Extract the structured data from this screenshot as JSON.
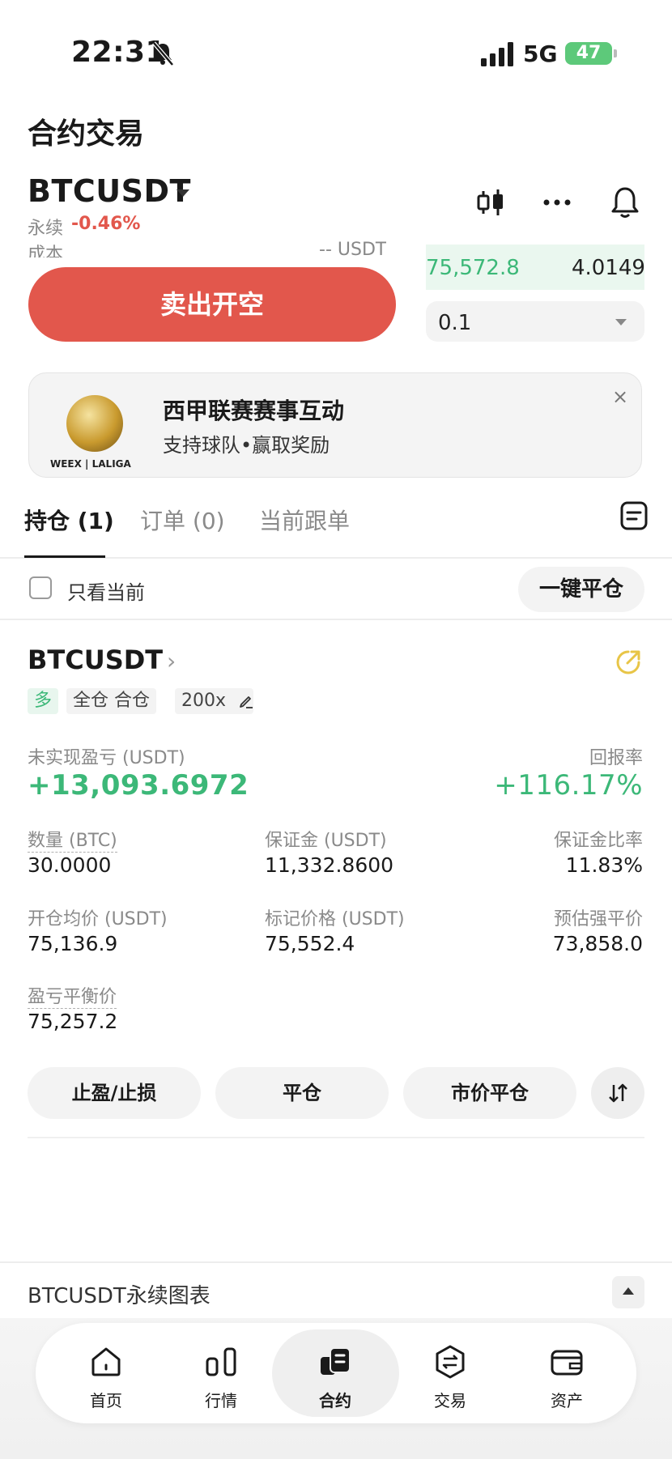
{
  "status_bar": {
    "time": "22:31",
    "network": "5G",
    "battery": "47"
  },
  "header": {
    "title": "合约交易"
  },
  "symbol": {
    "name": "BTCUSDT",
    "type": "永续",
    "change": "-0.46%"
  },
  "order_form": {
    "cost_label": "成本",
    "cost_value": "-- USDT",
    "sell_button": "卖出开空",
    "amount": "0.1"
  },
  "orderbook_row": {
    "price": "75,572.8",
    "qty": "4.0149"
  },
  "banner": {
    "title": "西甲联赛赛事互动",
    "subtitle": "支持球队•赢取奖励",
    "logo": "WEEX | LALIGA",
    "close": "×"
  },
  "tabs": [
    {
      "label": "持仓 (1)",
      "active": true
    },
    {
      "label": "订单 (0)",
      "active": false
    },
    {
      "label": "当前跟单",
      "active": false
    }
  ],
  "filter": {
    "only_current": "只看当前",
    "close_all": "一键平仓"
  },
  "position": {
    "symbol": "BTCUSDT",
    "tags": {
      "side": "多",
      "margin_mode": "全仓 合仓",
      "leverage": "200x"
    },
    "pnl_label": "未实现盈亏 (USDT)",
    "pnl_value": "+13,093.6972",
    "roe_label": "回报率",
    "roe_value": "+116.17%",
    "fields": {
      "qty_label": "数量 (BTC)",
      "qty_value": "30.0000",
      "margin_label": "保证金 (USDT)",
      "margin_value": "11,332.8600",
      "margin_ratio_label": "保证金比率",
      "margin_ratio_value": "11.83%",
      "entry_label": "开仓均价 (USDT)",
      "entry_value": "75,136.9",
      "mark_label": "标记价格 (USDT)",
      "mark_value": "75,552.4",
      "liq_label": "预估强平价",
      "liq_value": "73,858.0",
      "breakeven_label": "盈亏平衡价",
      "breakeven_value": "75,257.2"
    },
    "actions": {
      "tpsl": "止盈/止损",
      "close": "平仓",
      "market_close": "市价平仓"
    }
  },
  "chart_bar": {
    "label": "BTCUSDT永续图表"
  },
  "bottom_nav": [
    {
      "label": "首页",
      "icon": "home-icon"
    },
    {
      "label": "行情",
      "icon": "market-icon"
    },
    {
      "label": "合约",
      "icon": "futures-icon",
      "active": true
    },
    {
      "label": "交易",
      "icon": "trade-icon"
    },
    {
      "label": "资产",
      "icon": "wallet-icon"
    }
  ],
  "colors": {
    "red": "#e2574c",
    "green": "#3cb878",
    "gold": "#e8c547"
  }
}
